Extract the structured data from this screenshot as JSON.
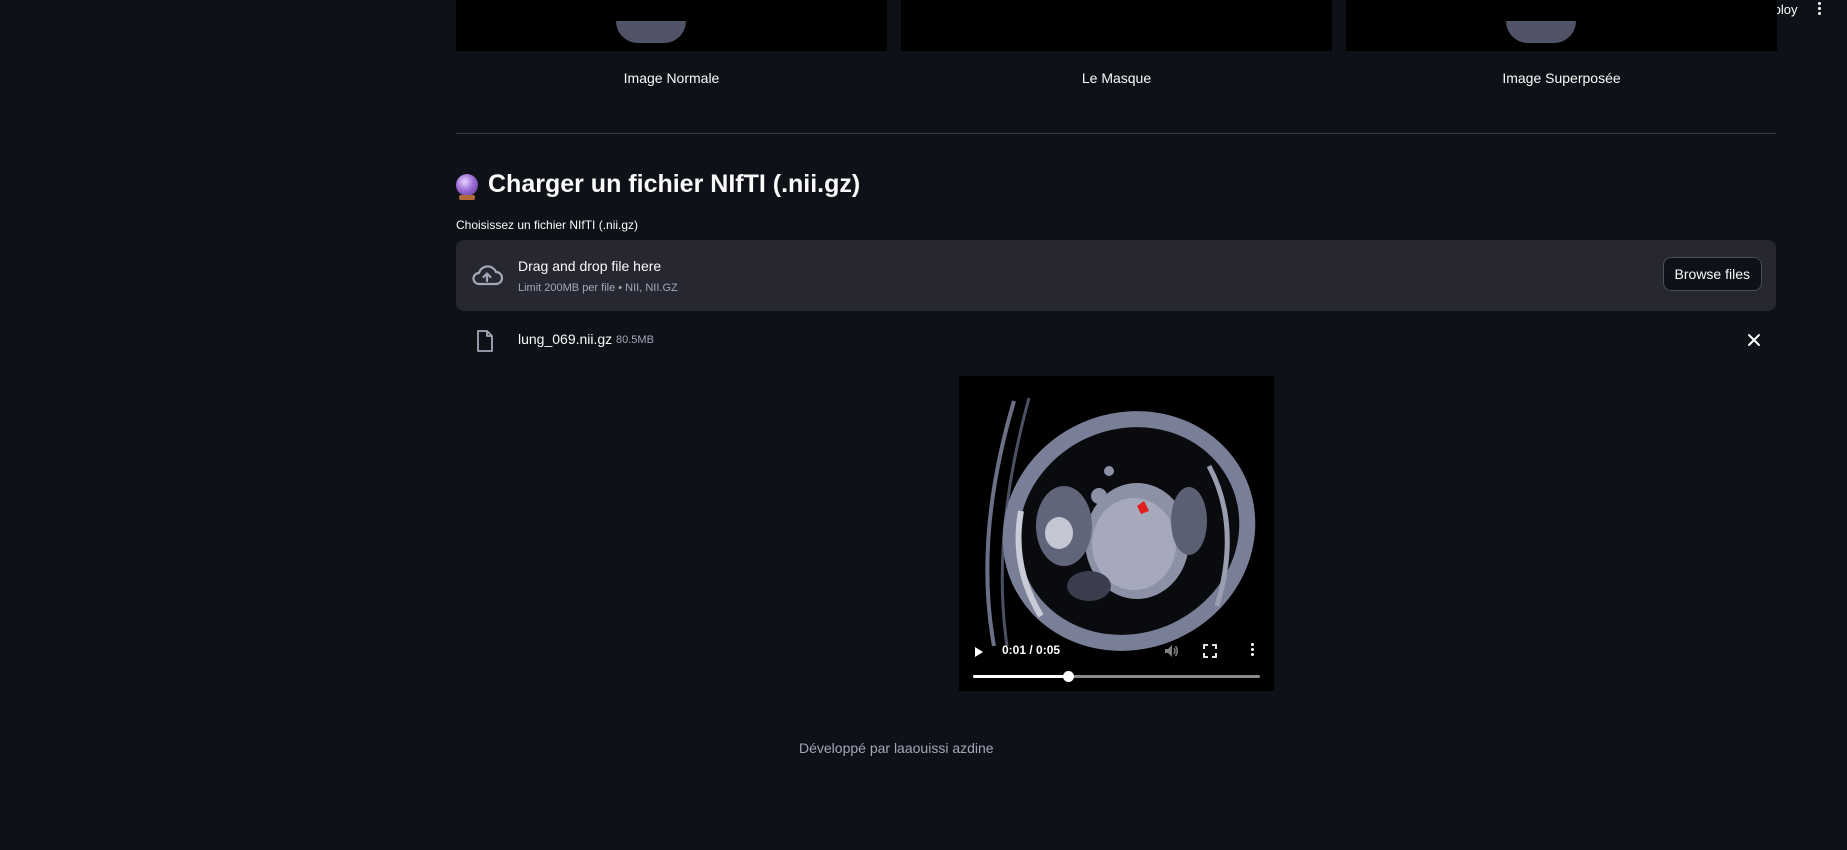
{
  "header": {
    "deploy_label": "Deploy"
  },
  "images": {
    "captions": [
      "Image Normale",
      "Le Masque",
      "Image Superposée"
    ]
  },
  "upload": {
    "heading": "Charger un fichier NIfTI (.nii.gz)",
    "label": "Choisissez un fichier NIfTI (.nii.gz)",
    "drop_title": "Drag and drop file here",
    "drop_subtitle": "Limit 200MB per file • NII, NII.GZ",
    "browse_label": "Browse files"
  },
  "uploaded_file": {
    "name": "lung_069.nii.gz",
    "size": "80.5MB"
  },
  "video": {
    "time": "0:01 / 0:05",
    "progress_fraction": 0.33
  },
  "footer": {
    "text": "Développé par laaouissi azdine"
  },
  "colors": {
    "background": "#0e1117",
    "dropzone": "#262730",
    "mask_red": "#e11d1d"
  }
}
